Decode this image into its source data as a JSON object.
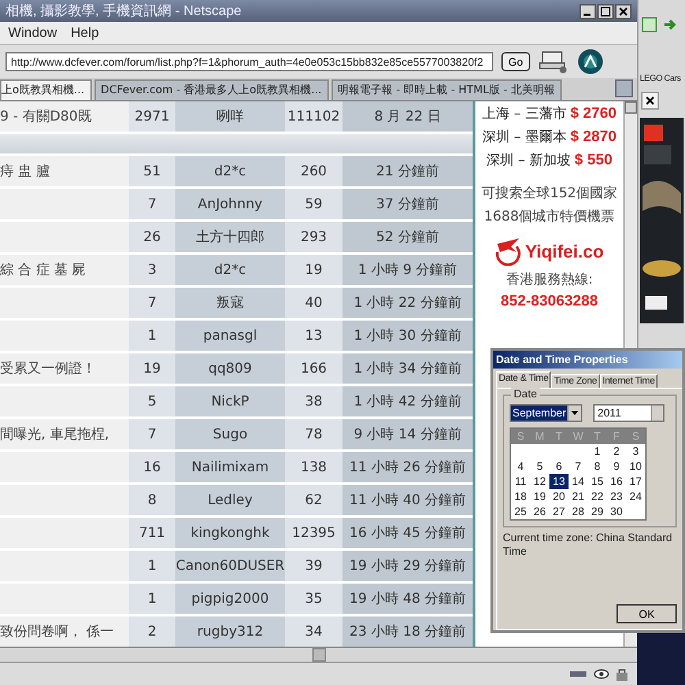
{
  "browser": {
    "title": "相機, 攝影教學, 手機資訊網 - Netscape",
    "menu": [
      "Window",
      "Help"
    ],
    "address": "http://www.dcfever.com/forum/list.php?f=1&phorum_auth=4e0e053c15bb832e85ce5577003820f2",
    "go_button": "Go",
    "tabs": [
      {
        "label": "上o既教異相機...",
        "selected": true
      },
      {
        "label": "DCFever.com - 香港最多人上o既教異相機...",
        "selected": false
      },
      {
        "label": "明報電子報 - 即時上載 - HTML版 - 北美明報",
        "selected": false
      }
    ]
  },
  "forum_table": {
    "rows": [
      {
        "kind": "topic",
        "title": "9 - 有關D80既",
        "replies": "2971",
        "author": "咧咩",
        "views": "111102",
        "last_post": "8 月 22 日"
      },
      {
        "kind": "separator"
      },
      {
        "kind": "topic",
        "title": "痔 盅 臚",
        "replies": "51",
        "author": "d2*c",
        "views": "260",
        "last_post": "21 分鐘前"
      },
      {
        "kind": "topic",
        "replies": "7",
        "author": "AnJohnny",
        "views": "59",
        "last_post": "37 分鐘前"
      },
      {
        "kind": "topic",
        "replies": "26",
        "author": "土方十四郎",
        "views": "293",
        "last_post": "52 分鐘前"
      },
      {
        "kind": "topic",
        "title": "綜 合 症 墓 屍",
        "replies": "3",
        "author": "d2*c",
        "views": "19",
        "last_post": "1 小時 9 分鐘前"
      },
      {
        "kind": "topic",
        "replies": "7",
        "author": "叛寇",
        "views": "40",
        "last_post": "1 小時 22 分鐘前"
      },
      {
        "kind": "topic",
        "replies": "1",
        "author": "panasgl",
        "views": "13",
        "last_post": "1 小時 30 分鐘前"
      },
      {
        "kind": "topic",
        "title": "受累又一例證！",
        "replies": "19",
        "author": "qq809",
        "views": "166",
        "last_post": "1 小時 34 分鐘前"
      },
      {
        "kind": "topic",
        "replies": "5",
        "author": "NickP",
        "views": "38",
        "last_post": "1 小時 42 分鐘前"
      },
      {
        "kind": "topic",
        "title": "間曝光, 車尾拖桯,",
        "replies": "7",
        "author": "Sugo",
        "views": "78",
        "last_post": "9 小時 14 分鐘前"
      },
      {
        "kind": "topic",
        "replies": "16",
        "author": "Nailimixam",
        "views": "138",
        "last_post": "11 小時 26 分鐘前"
      },
      {
        "kind": "topic",
        "replies": "8",
        "author": "Ledley",
        "views": "62",
        "last_post": "11 小時 40 分鐘前"
      },
      {
        "kind": "topic",
        "replies": "711",
        "author": "kingkonghk",
        "views": "12395",
        "last_post": "16 小時 45 分鐘前"
      },
      {
        "kind": "topic",
        "replies": "1",
        "author": "Canon60DUSER",
        "views": "39",
        "last_post": "19 小時 29 分鐘前"
      },
      {
        "kind": "topic",
        "replies": "1",
        "author": "pigpig2000",
        "views": "35",
        "last_post": "19 小時 48 分鐘前"
      },
      {
        "kind": "topic",
        "title": "致份問卷啊， 係一",
        "replies": "2",
        "author": "rugby312",
        "views": "34",
        "last_post": "23 小時 18 分鐘前"
      }
    ]
  },
  "ad": {
    "routes": [
      {
        "route": "上海 – 三藩市",
        "price": "$ 2760"
      },
      {
        "route": "深圳 – 墨爾本",
        "price": "$ 2870"
      },
      {
        "route": "深圳 – 新加坡",
        "price": "$ 550"
      }
    ],
    "lines": [
      "可搜索全球152個國家",
      "1688個城市特價機票"
    ],
    "logo": "Yiqifei.co",
    "hotline_label": "香港服務熱線:",
    "hotline": "852-83063288"
  },
  "side_window": {
    "tab": "LEGO Cars"
  },
  "dialog": {
    "title": "Date and Time Properties",
    "tabs": [
      {
        "label": "Date & Time",
        "selected": true
      },
      {
        "label": "Time Zone",
        "selected": false
      },
      {
        "label": "Internet Time",
        "selected": false
      }
    ],
    "group": "Date",
    "month": "September",
    "year": "2011",
    "weekdays": [
      "S",
      "M",
      "T",
      "W",
      "T",
      "F",
      "S"
    ],
    "weeks": [
      [
        {
          "day": "1",
          "selected": false
        },
        {
          "day": "2",
          "selected": false
        },
        {
          "day": "3",
          "selected": false
        }
      ],
      [
        {
          "day": "4",
          "selected": false
        },
        {
          "day": "5",
          "selected": false
        },
        {
          "day": "6",
          "selected": false
        },
        {
          "day": "7",
          "selected": false
        },
        {
          "day": "8",
          "selected": false
        },
        {
          "day": "9",
          "selected": false
        },
        {
          "day": "10",
          "selected": false
        }
      ],
      [
        {
          "day": "11",
          "selected": false
        },
        {
          "day": "12",
          "selected": false
        },
        {
          "day": "13",
          "selected": true
        },
        {
          "day": "14",
          "selected": false
        },
        {
          "day": "15",
          "selected": false
        },
        {
          "day": "16",
          "selected": false
        },
        {
          "day": "17",
          "selected": false
        }
      ],
      [
        {
          "day": "18",
          "selected": false
        },
        {
          "day": "19",
          "selected": false
        },
        {
          "day": "20",
          "selected": false
        },
        {
          "day": "21",
          "selected": false
        },
        {
          "day": "22",
          "selected": false
        },
        {
          "day": "23",
          "selected": false
        },
        {
          "day": "24",
          "selected": false
        }
      ],
      [
        {
          "day": "25",
          "selected": false
        },
        {
          "day": "26",
          "selected": false
        },
        {
          "day": "27",
          "selected": false
        },
        {
          "day": "28",
          "selected": false
        },
        {
          "day": "29",
          "selected": false
        },
        {
          "day": "30",
          "selected": false
        }
      ]
    ],
    "time_zone": "Current time zone:  China Standard Time",
    "ok_button": "OK"
  }
}
